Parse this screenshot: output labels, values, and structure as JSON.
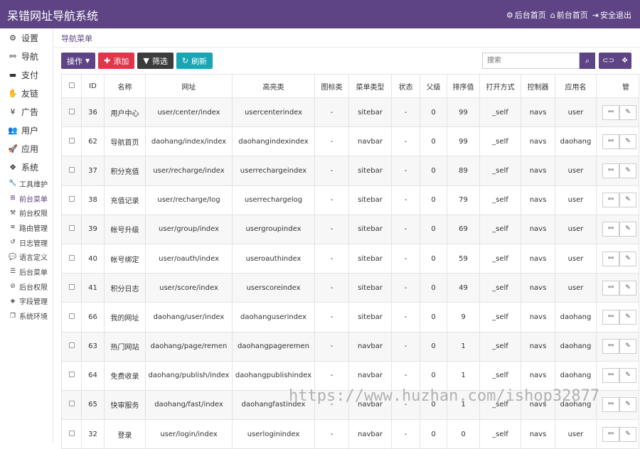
{
  "app": {
    "title": "呆错网址导航系统",
    "header_links": [
      {
        "icon": "gear-icon",
        "label": "后台首页"
      },
      {
        "icon": "home-icon",
        "label": "前台首页"
      },
      {
        "icon": "logout-icon",
        "label": "安全退出"
      }
    ]
  },
  "sidebar": {
    "items": [
      {
        "icon": "gears-icon",
        "glyph": "⚙",
        "label": "设置"
      },
      {
        "icon": "link-icon",
        "glyph": "⚯",
        "label": "导航"
      },
      {
        "icon": "visa-icon",
        "glyph": "▬",
        "label": "支付"
      },
      {
        "icon": "handshake-icon",
        "glyph": "✋",
        "label": "友链"
      },
      {
        "icon": "yen-icon",
        "glyph": "¥",
        "label": "广告"
      },
      {
        "icon": "users-icon",
        "glyph": "👥",
        "label": "用户"
      },
      {
        "icon": "rocket-icon",
        "glyph": "🚀",
        "label": "应用"
      },
      {
        "icon": "cubes-icon",
        "glyph": "❖",
        "label": "系统"
      }
    ],
    "sub_items": [
      {
        "icon": "wrench-icon",
        "glyph": "🔧",
        "label": "工具维护",
        "active": false
      },
      {
        "icon": "sitemap-icon",
        "glyph": "⊞",
        "label": "前台菜单",
        "active": true
      },
      {
        "icon": "gavel-icon",
        "glyph": "⚒",
        "label": "前台权限",
        "active": false
      },
      {
        "icon": "wifi-icon",
        "glyph": "≋",
        "label": "路由管理",
        "active": false
      },
      {
        "icon": "history-icon",
        "glyph": "↺",
        "label": "日志管理",
        "active": false
      },
      {
        "icon": "comment-icon",
        "glyph": "💬",
        "label": "语言定义",
        "active": false
      },
      {
        "icon": "list-icon",
        "glyph": "☰",
        "label": "后台菜单",
        "active": false
      },
      {
        "icon": "ban-icon",
        "glyph": "⊘",
        "label": "后台权限",
        "active": false
      },
      {
        "icon": "cube-icon",
        "glyph": "◈",
        "label": "字段管理",
        "active": false
      },
      {
        "icon": "copy-icon",
        "glyph": "❐",
        "label": "系统环境",
        "active": false
      }
    ]
  },
  "main": {
    "breadcrumb": "导航菜单",
    "toolbar": {
      "operate_label": "操作",
      "add_label": "添加",
      "filter_label": "筛选",
      "refresh_label": "刷新"
    },
    "search": {
      "placeholder": "搜索",
      "value": ""
    },
    "table": {
      "columns": [
        "ID",
        "名称",
        "网址",
        "高亮类",
        "图标类",
        "菜单类型",
        "状态",
        "父级",
        "排序值",
        "打开方式",
        "控制器",
        "应用名",
        "管"
      ],
      "rows": [
        {
          "id": "36",
          "name": "用户中心",
          "url": "user/center/index",
          "highlight": "usercenterindex",
          "icon": "-",
          "type": "sitebar",
          "status": "-",
          "parent": "0",
          "sort": "99",
          "open": "_self",
          "controller": "navs",
          "app": "user"
        },
        {
          "id": "62",
          "name": "导航首页",
          "url": "daohang/index/index",
          "highlight": "daohangindexindex",
          "icon": "-",
          "type": "navbar",
          "status": "-",
          "parent": "0",
          "sort": "99",
          "open": "_self",
          "controller": "navs",
          "app": "daohang"
        },
        {
          "id": "37",
          "name": "积分充值",
          "url": "user/recharge/index",
          "highlight": "userrechargeindex",
          "icon": "-",
          "type": "sitebar",
          "status": "-",
          "parent": "0",
          "sort": "89",
          "open": "_self",
          "controller": "navs",
          "app": "user"
        },
        {
          "id": "38",
          "name": "充值记录",
          "url": "user/recharge/log",
          "highlight": "userrechargelog",
          "icon": "-",
          "type": "sitebar",
          "status": "-",
          "parent": "0",
          "sort": "79",
          "open": "_self",
          "controller": "navs",
          "app": "user"
        },
        {
          "id": "39",
          "name": "帐号升级",
          "url": "user/group/index",
          "highlight": "usergroupindex",
          "icon": "-",
          "type": "sitebar",
          "status": "-",
          "parent": "0",
          "sort": "69",
          "open": "_self",
          "controller": "navs",
          "app": "user"
        },
        {
          "id": "40",
          "name": "帐号绑定",
          "url": "user/oauth/index",
          "highlight": "useroauthindex",
          "icon": "-",
          "type": "sitebar",
          "status": "-",
          "parent": "0",
          "sort": "59",
          "open": "_self",
          "controller": "navs",
          "app": "user"
        },
        {
          "id": "41",
          "name": "积分日志",
          "url": "user/score/index",
          "highlight": "userscoreindex",
          "icon": "-",
          "type": "sitebar",
          "status": "-",
          "parent": "0",
          "sort": "49",
          "open": "_self",
          "controller": "navs",
          "app": "user"
        },
        {
          "id": "66",
          "name": "我的网址",
          "url": "daohang/user/index",
          "highlight": "daohanguserindex",
          "icon": "-",
          "type": "sitebar",
          "status": "-",
          "parent": "0",
          "sort": "9",
          "open": "_self",
          "controller": "navs",
          "app": "daohang"
        },
        {
          "id": "63",
          "name": "热门网站",
          "url": "daohang/page/remen",
          "highlight": "daohangpageremen",
          "icon": "-",
          "type": "navbar",
          "status": "-",
          "parent": "0",
          "sort": "1",
          "open": "_self",
          "controller": "navs",
          "app": "daohang"
        },
        {
          "id": "64",
          "name": "免费收录",
          "url": "daohang/publish/index",
          "highlight": "daohangpublishindex",
          "icon": "-",
          "type": "navbar",
          "status": "-",
          "parent": "0",
          "sort": "1",
          "open": "_self",
          "controller": "navs",
          "app": "daohang"
        },
        {
          "id": "65",
          "name": "快审服务",
          "url": "daohang/fast/index",
          "highlight": "daohangfastindex",
          "icon": "-",
          "type": "navbar",
          "status": "-",
          "parent": "0",
          "sort": "1",
          "open": "_self",
          "controller": "navs",
          "app": "daohang"
        },
        {
          "id": "32",
          "name": "登录",
          "url": "user/login/index",
          "highlight": "userloginindex",
          "icon": "-",
          "type": "navbar",
          "status": "-",
          "parent": "0",
          "sort": "0",
          "open": "_self",
          "controller": "navs",
          "app": "user"
        }
      ]
    }
  },
  "watermark": "https://www.huzhan.com/ishop32877"
}
